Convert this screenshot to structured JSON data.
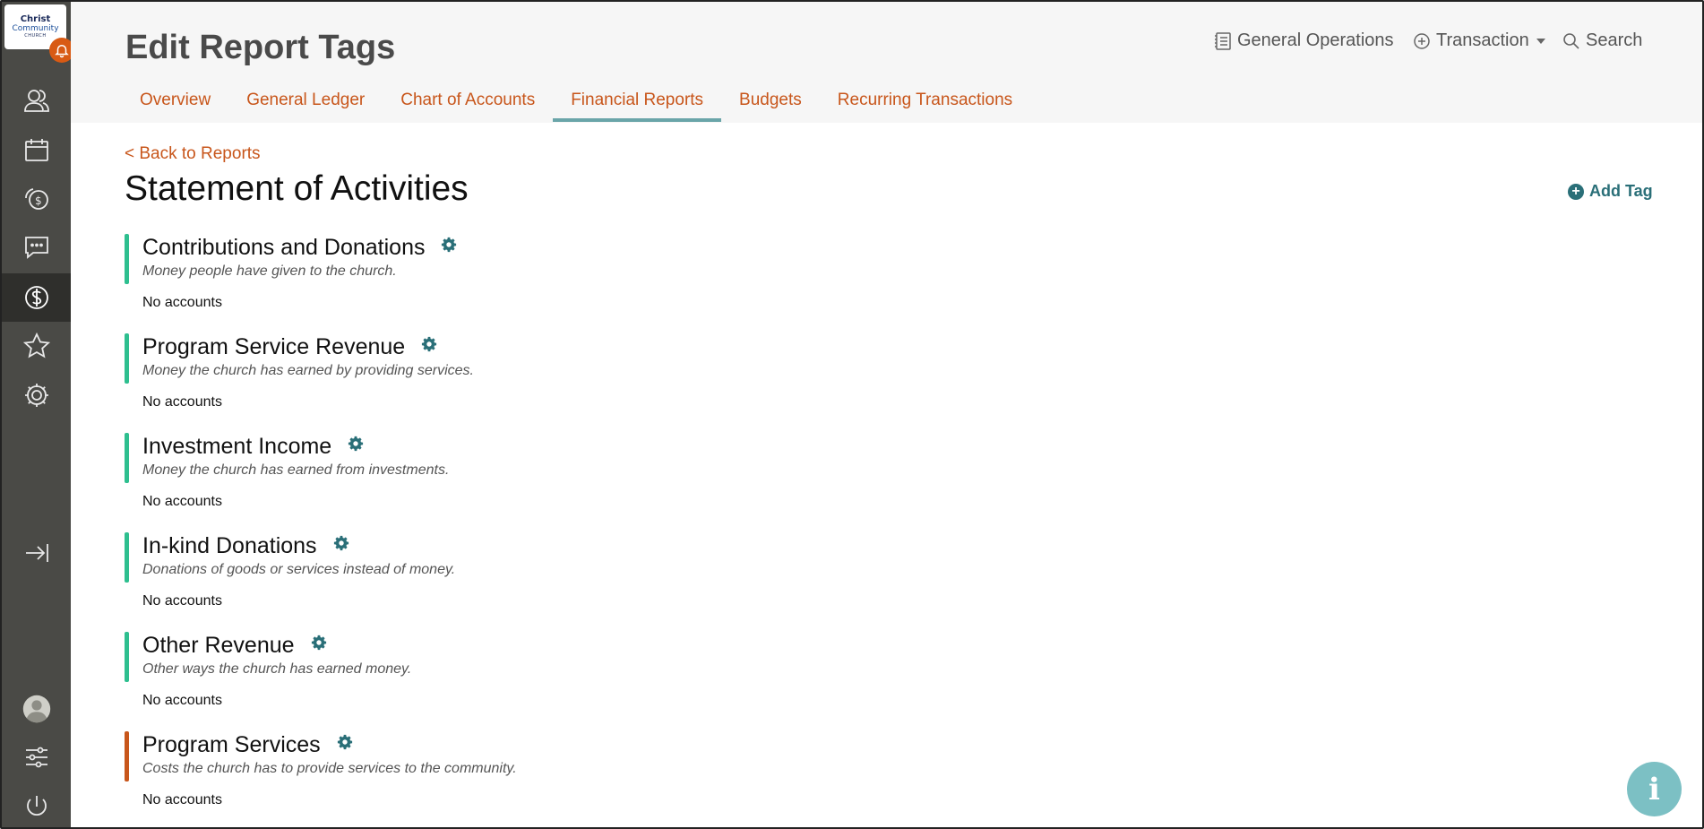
{
  "app": {
    "logo": {
      "line1": "Christ",
      "line2": "Community",
      "line3": "CHURCH"
    }
  },
  "sidebar": {
    "items": [
      {
        "icon": "people-icon"
      },
      {
        "icon": "calendar-icon"
      },
      {
        "icon": "giving-icon"
      },
      {
        "icon": "messages-icon"
      },
      {
        "icon": "finance-icon",
        "active": true
      },
      {
        "icon": "star-icon"
      },
      {
        "icon": "settings-icon"
      },
      {
        "icon": "expand-icon"
      },
      {
        "icon": "avatar"
      },
      {
        "icon": "sliders-icon"
      },
      {
        "icon": "power-icon"
      }
    ]
  },
  "header": {
    "title": "Edit Report Tags",
    "ledger_label": "General Operations",
    "transaction_label": "Transaction",
    "search_label": "Search",
    "tabs": [
      {
        "label": "Overview"
      },
      {
        "label": "General Ledger"
      },
      {
        "label": "Chart of Accounts"
      },
      {
        "label": "Financial Reports",
        "active": true
      },
      {
        "label": "Budgets"
      },
      {
        "label": "Recurring Transactions"
      }
    ]
  },
  "main": {
    "back_link": "< Back to Reports",
    "report_title": "Statement of Activities",
    "add_tag_label": "Add Tag",
    "tags": [
      {
        "name": "Contributions and Donations",
        "description": "Money people have given to the church.",
        "accounts": "No accounts",
        "color": "#2ebf8f"
      },
      {
        "name": "Program Service Revenue",
        "description": "Money the church has earned by providing services.",
        "accounts": "No accounts",
        "color": "#2ebf8f"
      },
      {
        "name": "Investment Income",
        "description": "Money the church has earned from investments.",
        "accounts": "No accounts",
        "color": "#2ebf8f"
      },
      {
        "name": "In-kind Donations",
        "description": "Donations of goods or services instead of money.",
        "accounts": "No accounts",
        "color": "#2ebf8f"
      },
      {
        "name": "Other Revenue",
        "description": "Other ways the church has earned money.",
        "accounts": "No accounts",
        "color": "#2ebf8f"
      },
      {
        "name": "Program Services",
        "description": "Costs the church has to provide services to the community.",
        "accounts": "No accounts",
        "color": "#c8561b"
      }
    ]
  },
  "colors": {
    "accent": "#c8561b",
    "teal": "#2a6f78",
    "sidebar": "#4a4a46",
    "revenue_bar": "#2ebf8f",
    "expense_bar": "#c8561b"
  }
}
